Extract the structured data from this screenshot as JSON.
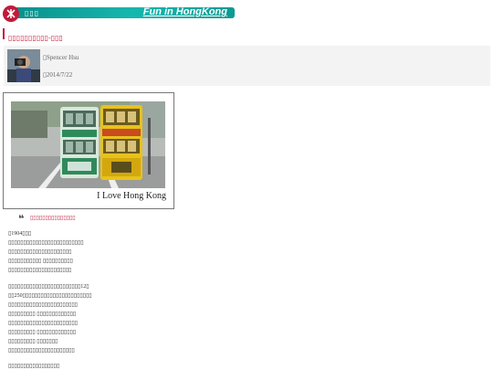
{
  "header": {
    "nav_text": "▯▯▯",
    "brand_text": "Fun in HongKong"
  },
  "article": {
    "title": "▯▯▯▯▯▯▯▯▯▯-▯▯▯"
  },
  "author": {
    "name": "▯Spencer Hsu",
    "date": "▯2014/7/22"
  },
  "figure": {
    "caption": "I Love Hong Kong",
    "tram_colors": [
      "#cfe3d8",
      "#e8c21c"
    ]
  },
  "quote": {
    "text": "▯▯▯▯▯▯▯▯▯▯▯▯▯▯▯"
  },
  "body": {
    "paragraph_1": [
      "▯1904▯▯▯",
      "▯▯▯▯▯▯▯▯▯▯▯▯▯▯▯▯▯▯▯▯▯▯▯▯▯",
      "▯▯▯▯▯▯▯▯▯▯▯▯▯▯▯▯▯▯▯▯▯",
      "▯▯▯▯▯▯▯▯▯▯▯ ▯▯▯▯▯▯▯▯▯▯",
      "▯▯▯▯▯▯▯▯▯▯▯▯▯▯▯▯▯▯▯▯▯"
    ],
    "paragraph_2": [
      "▯▯▯▯▯▯▯▯▯▯▯▯▯▯▯▯▯▯▯▯▯▯▯▯12▯",
      "▯▯250▯▯▯▯▯▯▯▯▯▯▯▯▯▯▯▯▯▯▯▯▯▯▯",
      "▯▯▯▯▯▯▯▯▯▯▯▯▯▯▯▯▯▯▯▯▯▯▯",
      "▯▯▯▯▯▯▯▯▯ ▯▯▯▯▯▯▯▯▯▯▯▯▯",
      "▯▯▯▯▯▯▯▯▯▯▯▯▯▯▯▯▯▯▯▯▯▯▯",
      "▯▯▯▯▯▯▯▯▯ ▯▯▯▯▯▯▯▯▯▯▯▯▯",
      "▯▯▯▯▯▯▯▯▯ ▯▯▯▯▯▯▯",
      "▯▯▯▯▯▯▯▯▯▯▯▯▯▯▯▯▯▯▯▯▯▯"
    ],
    "paragraph_3": [
      "▯▯▯▯▯▯▯▯▯▯▯▯▯▯▯▯▯"
    ]
  }
}
